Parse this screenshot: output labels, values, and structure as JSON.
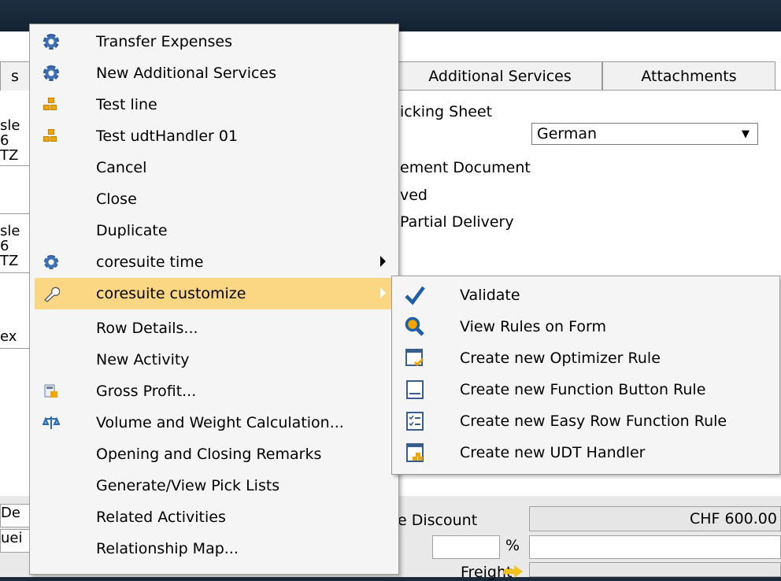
{
  "form": {
    "tabs": [
      "s",
      "Additional Services",
      "Attachments"
    ],
    "header_label": "icking Sheet",
    "language": "German",
    "lines": [
      "ement Document",
      "ved",
      "Partial Delivery"
    ],
    "left_fragments": [
      "sle",
      "6",
      "TZ",
      "sle",
      "6",
      "TZ",
      "ex",
      "De",
      "uei"
    ],
    "discount_label": "e Discount",
    "discount_value": "CHF 600.00",
    "percent": "%",
    "freight_label": "Freight"
  },
  "context_menu": {
    "items": [
      {
        "label": "Transfer Expenses",
        "icon": "gear-icon"
      },
      {
        "label": "New Additional Services",
        "icon": "gear-icon"
      },
      {
        "label": "Test line",
        "icon": "boxes-icon"
      },
      {
        "label": "Test udtHandler 01",
        "icon": "boxes-icon"
      },
      {
        "label": "Cancel",
        "icon": ""
      },
      {
        "label": "Close",
        "icon": ""
      },
      {
        "label": "Duplicate",
        "icon": ""
      },
      {
        "label": "coresuite time",
        "icon": "gears-icon",
        "submenu": true
      },
      {
        "label": "coresuite customize",
        "icon": "wrench-icon",
        "submenu": true,
        "highlighted": true
      },
      {
        "label": "Row Details...",
        "icon": ""
      },
      {
        "label": "New Activity",
        "icon": ""
      },
      {
        "label": "Gross Profit...",
        "icon": "calculator-icon"
      },
      {
        "label": "Volume and Weight Calculation...",
        "icon": "scale-icon"
      },
      {
        "label": "Opening and Closing Remarks",
        "icon": ""
      },
      {
        "label": "Generate/View Pick Lists",
        "icon": ""
      },
      {
        "label": "Related Activities",
        "icon": ""
      },
      {
        "label": "Relationship Map...",
        "icon": ""
      }
    ]
  },
  "submenu": {
    "items": [
      {
        "label": "Validate",
        "icon": "checkmark-icon"
      },
      {
        "label": "View Rules on Form",
        "icon": "magnifier-icon"
      },
      {
        "label": "Create new Optimizer Rule",
        "icon": "window-check-icon"
      },
      {
        "label": "Create new Function Button Rule",
        "icon": "window-button-icon"
      },
      {
        "label": "Create new Easy Row Function Rule",
        "icon": "window-list-icon"
      },
      {
        "label": "Create new UDT Handler",
        "icon": "window-boxes-icon"
      }
    ]
  },
  "colors": {
    "highlight": "#fbd784",
    "menu_bg": "#f5f5f5",
    "titlebar": "#1b2a3a",
    "accent_blue": "#2a6ab5",
    "accent_orange": "#f0a500"
  }
}
